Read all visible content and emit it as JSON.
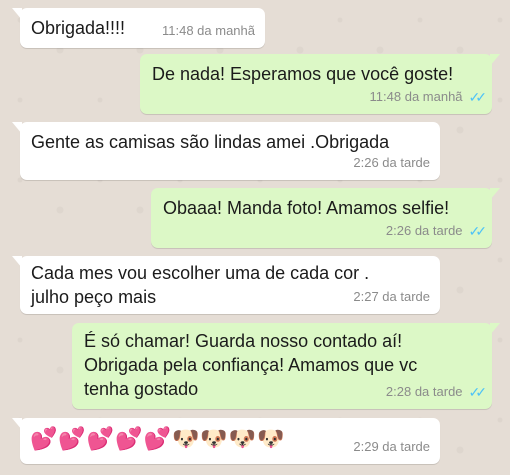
{
  "messages": [
    {
      "direction": "in",
      "text": "Obrigada!!!!",
      "time": "11:48 da manhã"
    },
    {
      "direction": "out",
      "text": "De nada! Esperamos que você goste!",
      "time": "11:48 da manhã",
      "status": "read"
    },
    {
      "direction": "in",
      "text": "Gente as camisas são lindas amei .Obrigada",
      "time": "2:26 da tarde"
    },
    {
      "direction": "out",
      "text": "Obaaa! Manda foto! Amamos selfie!",
      "time": "2:26 da tarde",
      "status": "read"
    },
    {
      "direction": "in",
      "line1": "Cada mes vou escolher uma de cada cor .",
      "line2": "julho peço mais",
      "time": "2:27 da tarde"
    },
    {
      "direction": "out",
      "line1": "É só chamar! Guarda nosso contado aí!",
      "line2": "Obrigada pela confiança! Amamos que vc",
      "line3": "tenha gostado",
      "time": "2:28 da tarde",
      "status": "read"
    },
    {
      "direction": "in",
      "text": "💕💕💕💕💕🐶🐶🐶🐶",
      "time": "2:29 da tarde"
    }
  ],
  "colors": {
    "incoming_bubble": "#ffffff",
    "outgoing_bubble": "#dcf8c6",
    "read_ticks": "#4fc3f7",
    "chat_background": "#e5ddd5"
  },
  "icons": {
    "read_receipt": "double-check-icon"
  }
}
